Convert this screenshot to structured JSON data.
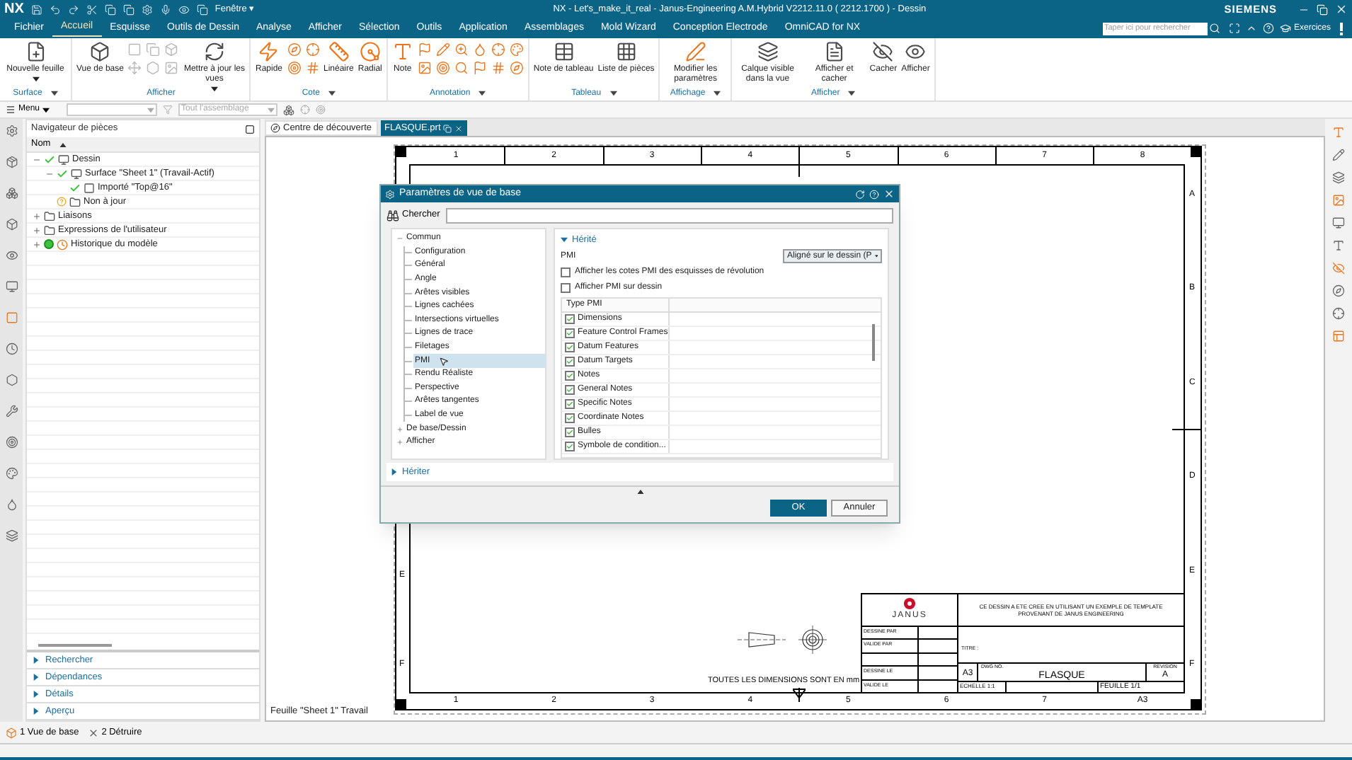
{
  "title_bar": {
    "app": "NX",
    "window_menu": "Fenêtre ▾",
    "title": "NX - Let's_make_it_real - Janus-Engineering A.M.Hybrid V2212.11.0 ( 2212.1700 ) - Dessin",
    "brand": "SIEMENS"
  },
  "menu_tabs": [
    {
      "label": "Fichier",
      "selected": false
    },
    {
      "label": "Accueil",
      "selected": true
    },
    {
      "label": "Esquisse",
      "selected": false
    },
    {
      "label": "Outils de Dessin",
      "selected": false
    },
    {
      "label": "Analyse",
      "selected": false
    },
    {
      "label": "Afficher",
      "selected": false
    },
    {
      "label": "Sélection",
      "selected": false
    },
    {
      "label": "Outils",
      "selected": false
    },
    {
      "label": "Application",
      "selected": false
    },
    {
      "label": "Assemblages",
      "selected": false
    },
    {
      "label": "Mold Wizard",
      "selected": false
    },
    {
      "label": "Conception Electrode",
      "selected": false
    },
    {
      "label": "OmniCAD for NX",
      "selected": false
    }
  ],
  "search": {
    "placeholder": "Taper ici pour rechercher"
  },
  "exercises": "Exercices",
  "ribbon": [
    {
      "label": "Surface",
      "menu": true,
      "buttons": [
        {
          "label": "Nouvelle feuille",
          "dropdown": true
        }
      ]
    },
    {
      "label": "Afficher",
      "menu": false,
      "buttons": [
        {
          "label": "Vue de base",
          "dropdown": false
        },
        {
          "label": "Mettre à jour les vues",
          "dropdown": true
        }
      ]
    },
    {
      "label": "Cote",
      "menu": true,
      "buttons": [
        {
          "label": "Rapide",
          "dropdown": false
        },
        {
          "label": "Linéaire",
          "dropdown": false
        },
        {
          "label": "Radial",
          "dropdown": false
        }
      ]
    },
    {
      "label": "Annotation",
      "menu": true,
      "buttons": [
        {
          "label": "Note",
          "dropdown": false
        }
      ]
    },
    {
      "label": "Tableau",
      "menu": true,
      "buttons": [
        {
          "label": "Note de tableau",
          "dropdown": false
        },
        {
          "label": "Liste de pièces",
          "dropdown": false
        }
      ]
    },
    {
      "label": "Affichage",
      "menu": true,
      "buttons": [
        {
          "label": "Modifier les paramètres",
          "dropdown": false
        }
      ]
    },
    {
      "label": "Afficher",
      "menu": true,
      "buttons": [
        {
          "label": "Calque visible dans la vue",
          "dropdown": false
        },
        {
          "label": "Afficher et cacher",
          "dropdown": false
        },
        {
          "label": "Cacher",
          "dropdown": false
        },
        {
          "label": "Afficher",
          "dropdown": false
        }
      ]
    }
  ],
  "toolbar": {
    "menu": "Menu",
    "scope_placeholder": "Tout l'assemblage"
  },
  "navigator": {
    "title": "Navigateur de pièces",
    "column": "Nom",
    "tree": [
      {
        "label": "Dessin",
        "kind": "drawing",
        "checked": true,
        "outdated": false,
        "loaded": false,
        "expanded": true,
        "children": [
          {
            "label": "Surface \"Sheet 1\" (Travail-Actif)",
            "kind": "sheet",
            "checked": true,
            "outdated": false,
            "loaded": false,
            "expanded": true,
            "children": [
              {
                "label": "Importé \"Top@16\"",
                "kind": "view",
                "checked": true,
                "outdated": false,
                "loaded": false
              }
            ]
          },
          {
            "label": "Non à jour",
            "kind": "folder",
            "checked": false,
            "outdated": true,
            "loaded": false
          }
        ]
      },
      {
        "label": "Liaisons",
        "kind": "folder",
        "checked": false,
        "outdated": false,
        "loaded": false,
        "expanded": false
      },
      {
        "label": "Expressions de l'utilisateur",
        "kind": "folder",
        "checked": false,
        "outdated": false,
        "loaded": false,
        "expanded": false
      },
      {
        "label": "Historique du modèle",
        "kind": "history",
        "checked": false,
        "outdated": false,
        "loaded": true,
        "expanded": false
      }
    ],
    "sections": [
      {
        "label": "Rechercher",
        "expanded": false
      },
      {
        "label": "Dépendances",
        "expanded": false
      },
      {
        "label": "Détails",
        "expanded": false
      },
      {
        "label": "Aperçu",
        "expanded": false
      }
    ]
  },
  "graphics_tabs": [
    {
      "label": "Centre de découverte",
      "selected": false
    },
    {
      "label": "FLASQUE.prt",
      "selected": true
    }
  ],
  "drawing": {
    "top_zones": [
      "1",
      "2",
      "3",
      "4",
      "5",
      "6",
      "7",
      "8"
    ],
    "bottom_zones": [
      "1",
      "2",
      "3",
      "4",
      "5",
      "6",
      "7",
      "A3"
    ],
    "right_zones": [
      "A",
      "B",
      "C",
      "D",
      "E",
      "F"
    ],
    "left_zones": [
      "E",
      "F"
    ],
    "units_note": "TOUTES LES DIMENSIONS SONT EN mm",
    "sheet_label": "Feuille \"Sheet 1\" Travail",
    "title_block": {
      "company": "JANUS",
      "note": "CE DESSIN A ETE CREE EN UTILISANT UN EXEMPLE DE TEMPLATE PROVENANT DE JANUS ENGINEERING",
      "fields": [
        "DESSINE PAR",
        "VALIDE PAR",
        "DESSINE LE",
        "VALIDE LE"
      ],
      "title_label": "TITRE :",
      "size": "A3",
      "dwg_label": "DWG NO.",
      "dwg": "FLASQUE",
      "revision_label": "REVISION",
      "revision": "A",
      "scale": "ECHELLE 1:1",
      "sheet": "FEUILLE 1/1"
    }
  },
  "dialog": {
    "title": "Paramètres de vue de base",
    "search_label": "Chercher",
    "tree": [
      {
        "label": "Commun",
        "expanded": true,
        "children": [
          {
            "label": "Configuration",
            "selected": false
          },
          {
            "label": "Général",
            "selected": false
          },
          {
            "label": "Angle",
            "selected": false
          },
          {
            "label": "Arêtes visibles",
            "selected": false
          },
          {
            "label": "Lignes cachées",
            "selected": false
          },
          {
            "label": "Intersections virtuelles",
            "selected": false
          },
          {
            "label": "Lignes de trace",
            "selected": false
          },
          {
            "label": "Filetages",
            "selected": false
          },
          {
            "label": "PMI",
            "selected": true
          },
          {
            "label": "Rendu Réaliste",
            "selected": false
          },
          {
            "label": "Perspective",
            "selected": false
          },
          {
            "label": "Arêtes tangentes",
            "selected": false
          },
          {
            "label": "Label de vue",
            "selected": false
          }
        ]
      },
      {
        "label": "De base/Dessin",
        "expanded": false
      },
      {
        "label": "Afficher",
        "expanded": false
      }
    ],
    "section": {
      "label": "Hérité",
      "expanded": true
    },
    "pmi_label": "PMI",
    "pmi_value": "Aligné sur le dessin (P",
    "options": [
      {
        "label": "Afficher les cotes PMI des esquisses de révolution",
        "checked": false
      },
      {
        "label": "Afficher PMI sur dessin",
        "checked": false
      }
    ],
    "table_header": "Type PMI",
    "pmi_types": [
      {
        "label": "Dimensions",
        "checked": true
      },
      {
        "label": "Feature Control Frames",
        "checked": true
      },
      {
        "label": "Datum Features",
        "checked": true
      },
      {
        "label": "Datum Targets",
        "checked": true
      },
      {
        "label": "Notes",
        "checked": true
      },
      {
        "label": "General Notes",
        "checked": true
      },
      {
        "label": "Specific Notes",
        "checked": true
      },
      {
        "label": "Coordinate Notes",
        "checked": true
      },
      {
        "label": "Bulles",
        "checked": true
      },
      {
        "label": "Symbole de condition...",
        "checked": true
      }
    ],
    "collapsed_section": {
      "label": "Hériter",
      "expanded": false
    },
    "buttons": [
      {
        "label": "OK",
        "kind": "primary"
      },
      {
        "label": "Annuler",
        "kind": "secondary"
      }
    ]
  },
  "status_items": [
    {
      "label": "1 Vue de base"
    },
    {
      "label": "2 Détruire"
    }
  ]
}
